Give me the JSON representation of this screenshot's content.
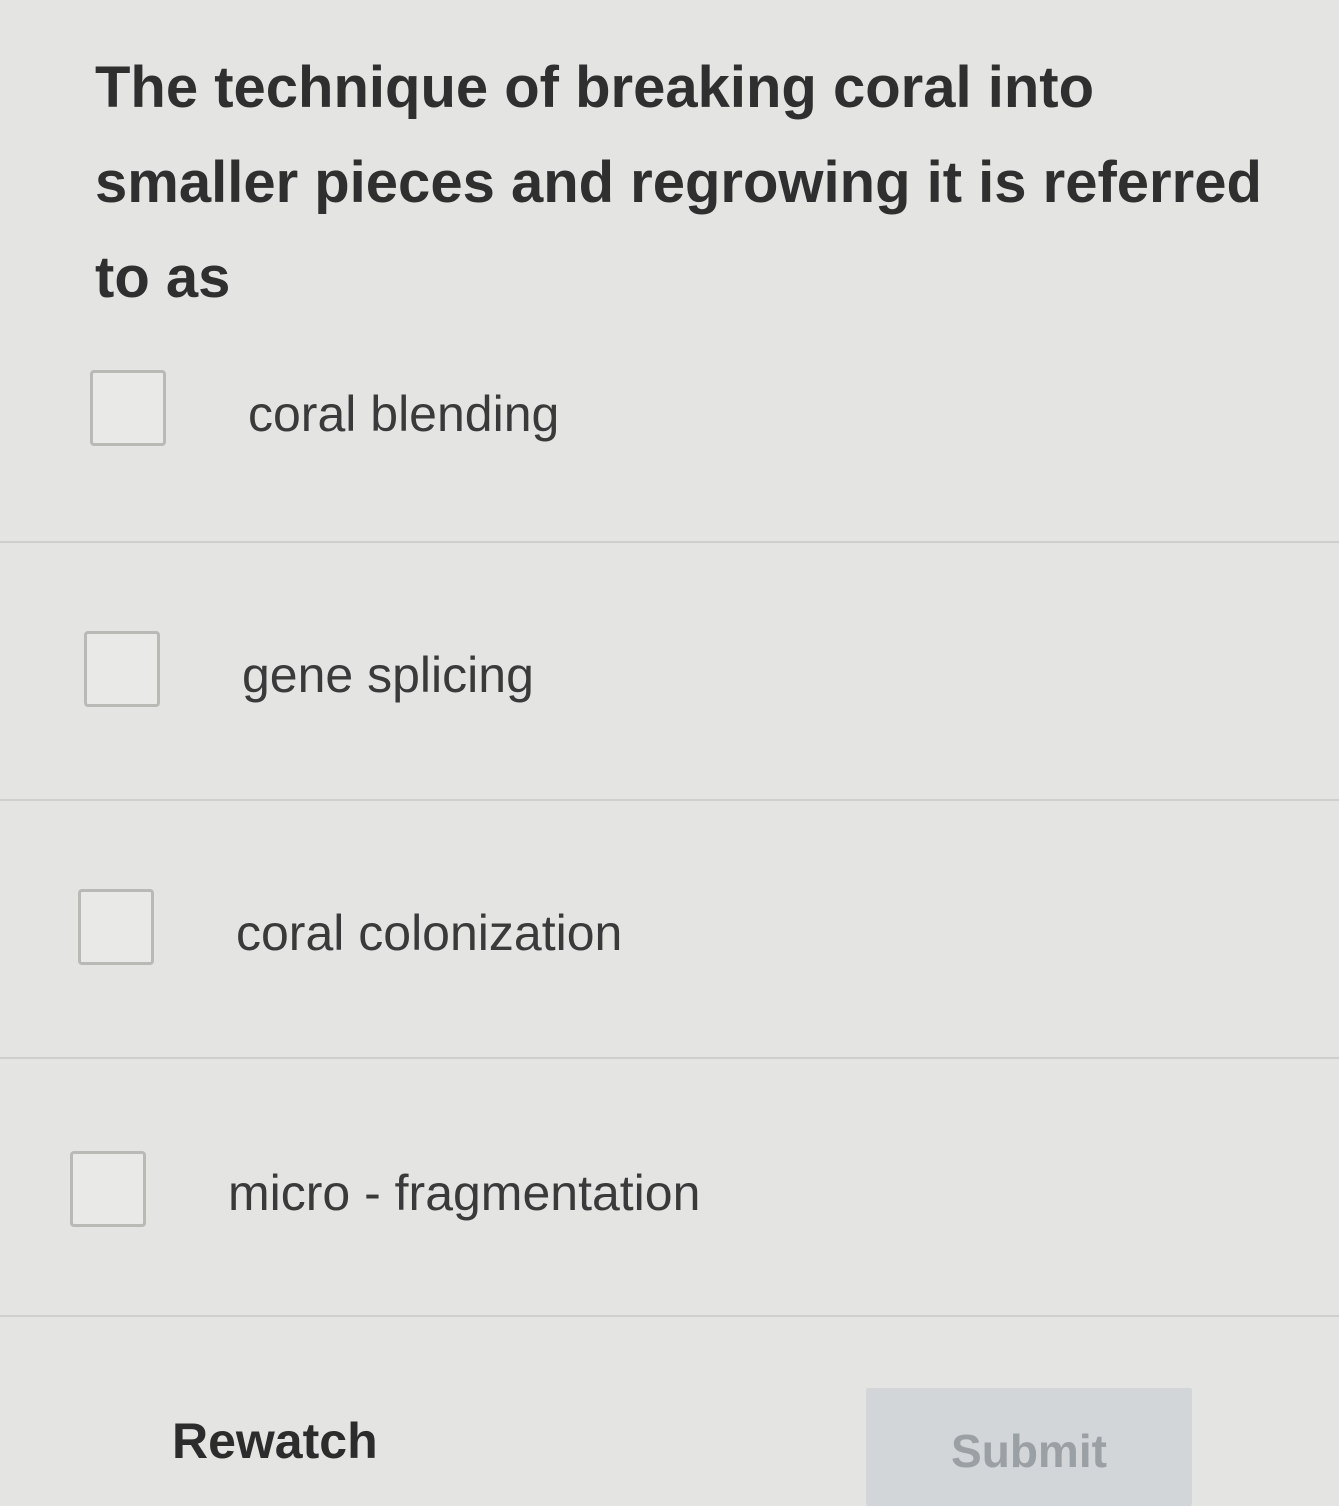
{
  "question": {
    "text": "The technique of breaking coral into smaller pieces and regrowing it is referred to as"
  },
  "options": [
    {
      "label": "coral blending",
      "checked": false
    },
    {
      "label": "gene splicing",
      "checked": false
    },
    {
      "label": "coral colonization",
      "checked": false
    },
    {
      "label": "micro - fragmentation",
      "checked": false
    }
  ],
  "footer": {
    "rewatch_label": "Rewatch",
    "submit_label": "Submit",
    "submit_enabled": false
  },
  "colors": {
    "background": "#e4e4e2",
    "submit_disabled_bg": "#d2d6d9",
    "submit_disabled_text": "#9aa0a4"
  }
}
